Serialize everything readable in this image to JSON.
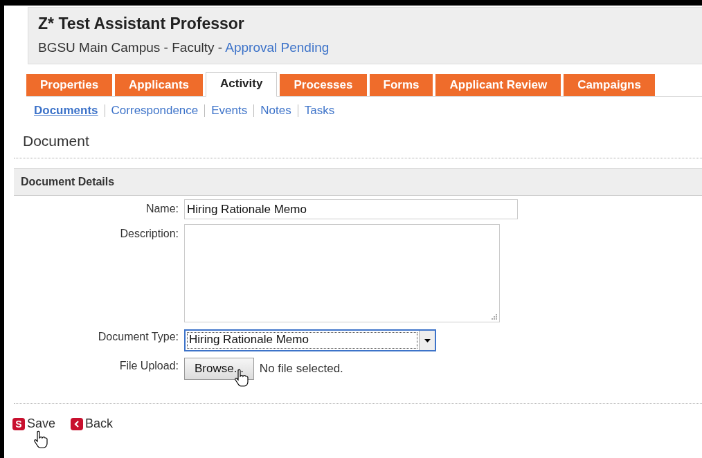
{
  "header": {
    "title": "Z* Test Assistant Professor",
    "subtitle": "BGSU Main Campus - Faculty - ",
    "status": "Approval Pending"
  },
  "tabs": [
    {
      "label": "Properties",
      "selected": false
    },
    {
      "label": "Applicants",
      "selected": false
    },
    {
      "label": "Activity",
      "selected": true
    },
    {
      "label": "Processes",
      "selected": false
    },
    {
      "label": "Forms",
      "selected": false
    },
    {
      "label": "Applicant Review",
      "selected": false
    },
    {
      "label": "Campaigns",
      "selected": false
    }
  ],
  "subnav": [
    {
      "label": "Documents",
      "selected": true
    },
    {
      "label": "Correspondence",
      "selected": false
    },
    {
      "label": "Events",
      "selected": false
    },
    {
      "label": "Notes",
      "selected": false
    },
    {
      "label": "Tasks",
      "selected": false
    }
  ],
  "page_title": "Document",
  "section": {
    "title": "Document Details"
  },
  "form": {
    "name": {
      "label": "Name:",
      "value": "Hiring Rationale Memo"
    },
    "description": {
      "label": "Description:"
    },
    "document_type": {
      "label": "Document Type:",
      "value": "Hiring Rationale Memo"
    },
    "file_upload": {
      "label": "File Upload:",
      "button": "Browse...",
      "status": "No file selected."
    }
  },
  "actions": [
    {
      "kind": "save",
      "icon": "S",
      "label": "Save"
    },
    {
      "kind": "back",
      "label": "Back"
    }
  ]
}
